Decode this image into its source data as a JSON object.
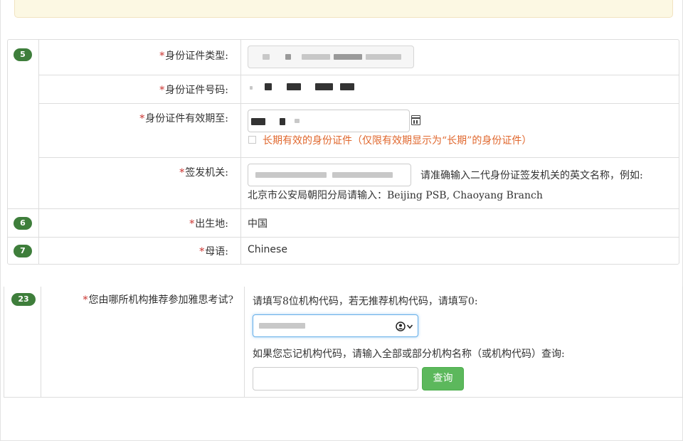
{
  "colors": {
    "badge_green": "#3e7e3b",
    "required_star": "#c9302c",
    "hint_orange": "#e0672d",
    "query_button": "#5cb85c",
    "notice_bg": "#fcf8e3"
  },
  "section1": {
    "rows": [
      {
        "badge": "5",
        "label": "身份证件类型:",
        "required": "*"
      },
      {
        "label": "身份证件号码:",
        "required": "*"
      },
      {
        "label": "身份证件有效期至:",
        "required": "*"
      },
      {
        "label": "签发机关:",
        "required": "*"
      },
      {
        "badge": "6",
        "label": "出生地:",
        "required": "*"
      },
      {
        "badge": "7",
        "label": "母语:",
        "required": "*"
      }
    ],
    "long_term_checkbox_label": "长期有效的身份证件（仅限有效期显示为“长期”的身份证件）",
    "issuing_authority_hint": "请准确输入二代身份证签发机关的英文名称，例如:",
    "issuing_authority_example": "北京市公安局朝阳分局请输入：Beijing PSB, Chaoyang Branch",
    "birthplace_value": "中国",
    "native_language_value": "Chinese",
    "calendar_icon": "calendar-icon"
  },
  "section2": {
    "badge": "23",
    "required": "*",
    "label": "您由哪所机构推荐参加雅思考试?",
    "code_hint": "请填写8位机构代码，若无推荐机构代码，请填写0:",
    "lookup_hint": "如果您忘记机构代码，请输入全部或部分机构名称（或机构代码）查询:",
    "query_button": "查询",
    "select_icon": "user-circle-icon"
  }
}
